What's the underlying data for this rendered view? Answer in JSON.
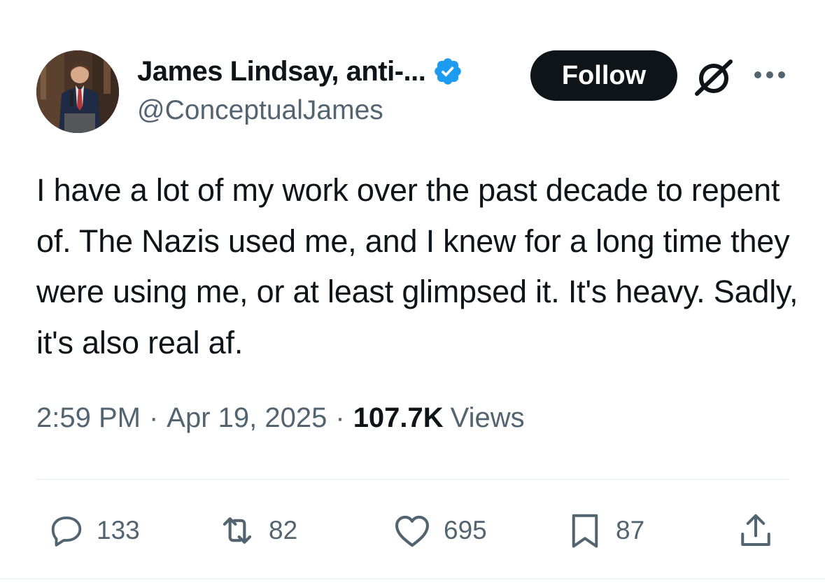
{
  "author": {
    "display_name": "James Lindsay, anti-...",
    "handle": "@ConceptualJames",
    "verified_icon": "verified-badge-icon",
    "avatar_icon": "avatar-photo"
  },
  "actions_header": {
    "follow_label": "Follow",
    "grok_icon": "grok-icon",
    "more_icon": "more-options-icon"
  },
  "tweet": {
    "text": "I have a lot of my work over the past decade to repent of. The Nazis used me, and I knew for a long time they were using me, or at least glimpsed it. It's heavy. Sadly, it's also real af."
  },
  "meta": {
    "time": "2:59 PM",
    "separator": "·",
    "date": "Apr 19, 2025",
    "views_count": "107.7K",
    "views_label": "Views"
  },
  "actions": {
    "replies": "133",
    "reposts": "82",
    "likes": "695",
    "bookmarks": "87"
  },
  "colors": {
    "text": "#0f1419",
    "secondary": "#536471",
    "verified": "#1d9bf0",
    "follow_bg": "#0f1419"
  }
}
